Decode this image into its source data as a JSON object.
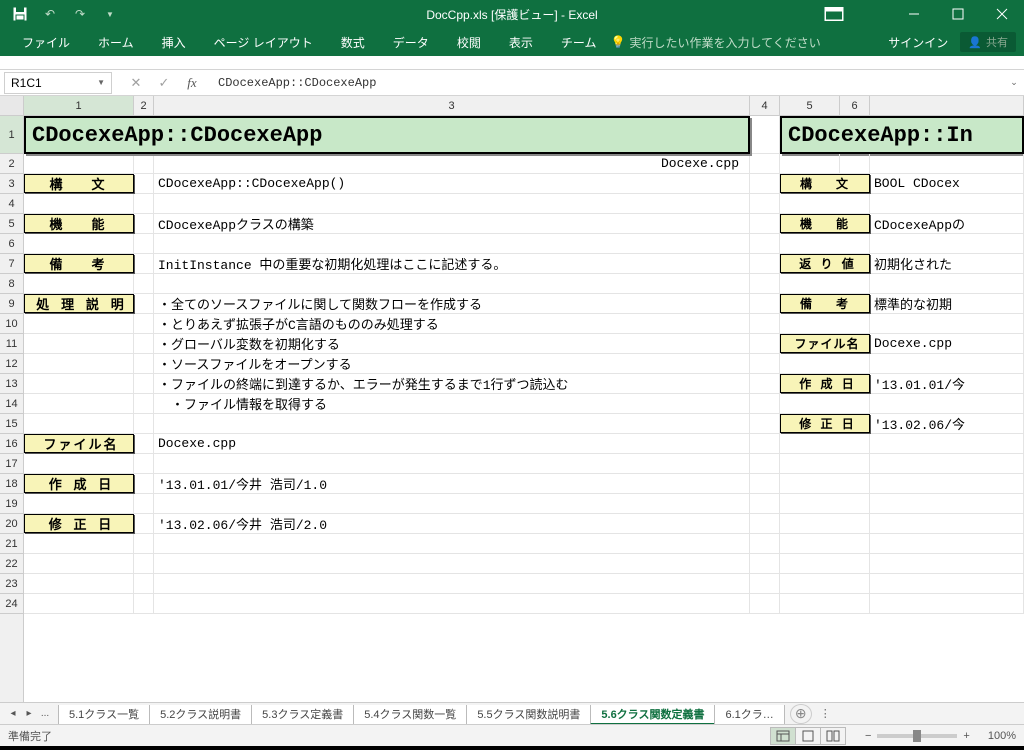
{
  "titlebar": {
    "title": "DocCpp.xls [保護ビュー] - Excel"
  },
  "window": {
    "ribbon_mode_tooltip": "リボン表示オプション"
  },
  "ribbon": {
    "tabs": [
      "ファイル",
      "ホーム",
      "挿入",
      "ページ レイアウト",
      "数式",
      "データ",
      "校閲",
      "表示",
      "チーム"
    ],
    "tell_me": "実行したい作業を入力してください",
    "signin": "サインイン",
    "share": "共有"
  },
  "formula": {
    "name_box": "R1C1",
    "value": "CDocexeApp::CDocexeApp"
  },
  "columns": [
    "1",
    "2",
    "3",
    "4",
    "5",
    "6"
  ],
  "rows": [
    "1",
    "2",
    "3",
    "4",
    "5",
    "6",
    "7",
    "8",
    "9",
    "10",
    "11",
    "12",
    "13",
    "14",
    "15",
    "16",
    "17",
    "18",
    "19",
    "20",
    "21",
    "22",
    "23",
    "24"
  ],
  "left": {
    "title": "CDocexeApp::CDocexeApp",
    "srcfile": "Docexe.cpp",
    "rows": [
      {
        "label": "構　文",
        "text": "CDocexeApp::CDocexeApp()"
      },
      {
        "label": "",
        "text": ""
      },
      {
        "label": "機　能",
        "text": "CDocexeAppクラスの構築"
      },
      {
        "label": "",
        "text": ""
      },
      {
        "label": "備　考",
        "text": "InitInstance 中の重要な初期化処理はここに記述する。"
      },
      {
        "label": "",
        "text": ""
      },
      {
        "label": "処 理 説 明",
        "text": "・全てのソースファイルに関して関数フローを作成する"
      },
      {
        "label": "",
        "text": "・とりあえず拡張子がC言語のもののみ処理する"
      },
      {
        "label": "",
        "text": "・グローバル変数を初期化する"
      },
      {
        "label": "",
        "text": "・ソースファイルをオープンする"
      },
      {
        "label": "",
        "text": "・ファイルの終端に到達するか、エラーが発生するまで1行ずつ読込む"
      },
      {
        "label": "",
        "text": "　・ファイル情報を取得する"
      },
      {
        "label": "",
        "text": ""
      },
      {
        "label": "ファイル名",
        "text": "Docexe.cpp"
      },
      {
        "label": "",
        "text": ""
      },
      {
        "label": "作 成 日",
        "text": "'13.01.01/今井 浩司/1.0"
      },
      {
        "label": "",
        "text": ""
      },
      {
        "label": "修 正 日",
        "text": "'13.02.06/今井 浩司/2.0"
      }
    ]
  },
  "right": {
    "title": "CDocexeApp::In",
    "rows": [
      {
        "label": "構　文",
        "text": "BOOL CDocex"
      },
      {
        "label": "",
        "text": ""
      },
      {
        "label": "機　能",
        "text": "CDocexeAppの"
      },
      {
        "label": "",
        "text": ""
      },
      {
        "label": "返 り 値",
        "text": "初期化された"
      },
      {
        "label": "",
        "text": ""
      },
      {
        "label": "備　考",
        "text": "標準的な初期"
      },
      {
        "label": "",
        "text": ""
      },
      {
        "label": "ファイル名",
        "text": "Docexe.cpp"
      },
      {
        "label": "",
        "text": ""
      },
      {
        "label": "作 成 日",
        "text": "'13.01.01/今"
      },
      {
        "label": "",
        "text": ""
      },
      {
        "label": "修 正 日",
        "text": "'13.02.06/今"
      }
    ]
  },
  "tabs": {
    "sheets": [
      "5.1クラス一覧",
      "5.2クラス説明書",
      "5.3クラス定義書",
      "5.4クラス関数一覧",
      "5.5クラス関数説明書",
      "5.6クラス関数定義書",
      "6.1クラ…"
    ],
    "active_index": 5,
    "ellipsis": "..."
  },
  "status": {
    "ready": "準備完了",
    "zoom": "100%"
  }
}
